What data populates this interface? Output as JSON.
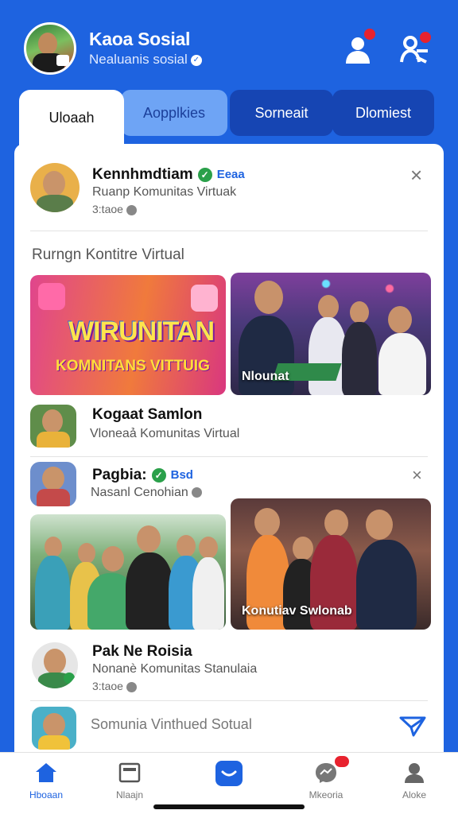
{
  "colors": {
    "brand": "#1e63e0",
    "notification": "#e8222e",
    "verified": "#2aa04a"
  },
  "header": {
    "title": "Kaoa Sosial",
    "subtitle": "Nealuanis sosial",
    "icons": [
      "profile-icon",
      "friends-icon"
    ]
  },
  "tabs": [
    {
      "label": "Uloaah"
    },
    {
      "label": "Aopplkies"
    },
    {
      "label": "Sorneait"
    },
    {
      "label": "Dlomiest"
    }
  ],
  "posts": [
    {
      "name": "Kennhmdtiam",
      "tag": "Eeaa",
      "subtitle": "Ruanp Komunitas Virtuak",
      "time": "3:taoe"
    },
    {
      "name": "Kogaat Samlon",
      "subtitle": "Vloneaả Komunitas  Virtual"
    },
    {
      "name": "Pagbia:",
      "tag": "Bsd",
      "subtitle": "Nasanl Cenohian"
    },
    {
      "name": "Pak Ne Roisia",
      "subtitle": "Nonanè Komunitas Stanulaia",
      "time": "3:taoe"
    },
    {
      "name": "Somunia Vinthued Sotual"
    }
  ],
  "section_label": "Rurngn Kontitre  Virtual",
  "photos": {
    "banner_title": "WIRUNITAN",
    "banner_sub": "KOMNITANS VITTUIG",
    "photo1_caption": "Nlounat",
    "photo4_caption": "Konutiav Swlonab"
  },
  "nav": [
    {
      "label": "Hboaan",
      "icon": "home-icon",
      "active": true
    },
    {
      "label": "Nlaajn",
      "icon": "news-icon"
    },
    {
      "label": "",
      "icon": "chat-bubble-icon"
    },
    {
      "label": "Mkeoria",
      "icon": "messenger-icon",
      "badge": true
    },
    {
      "label": "Aloke",
      "icon": "profile-icon"
    }
  ]
}
